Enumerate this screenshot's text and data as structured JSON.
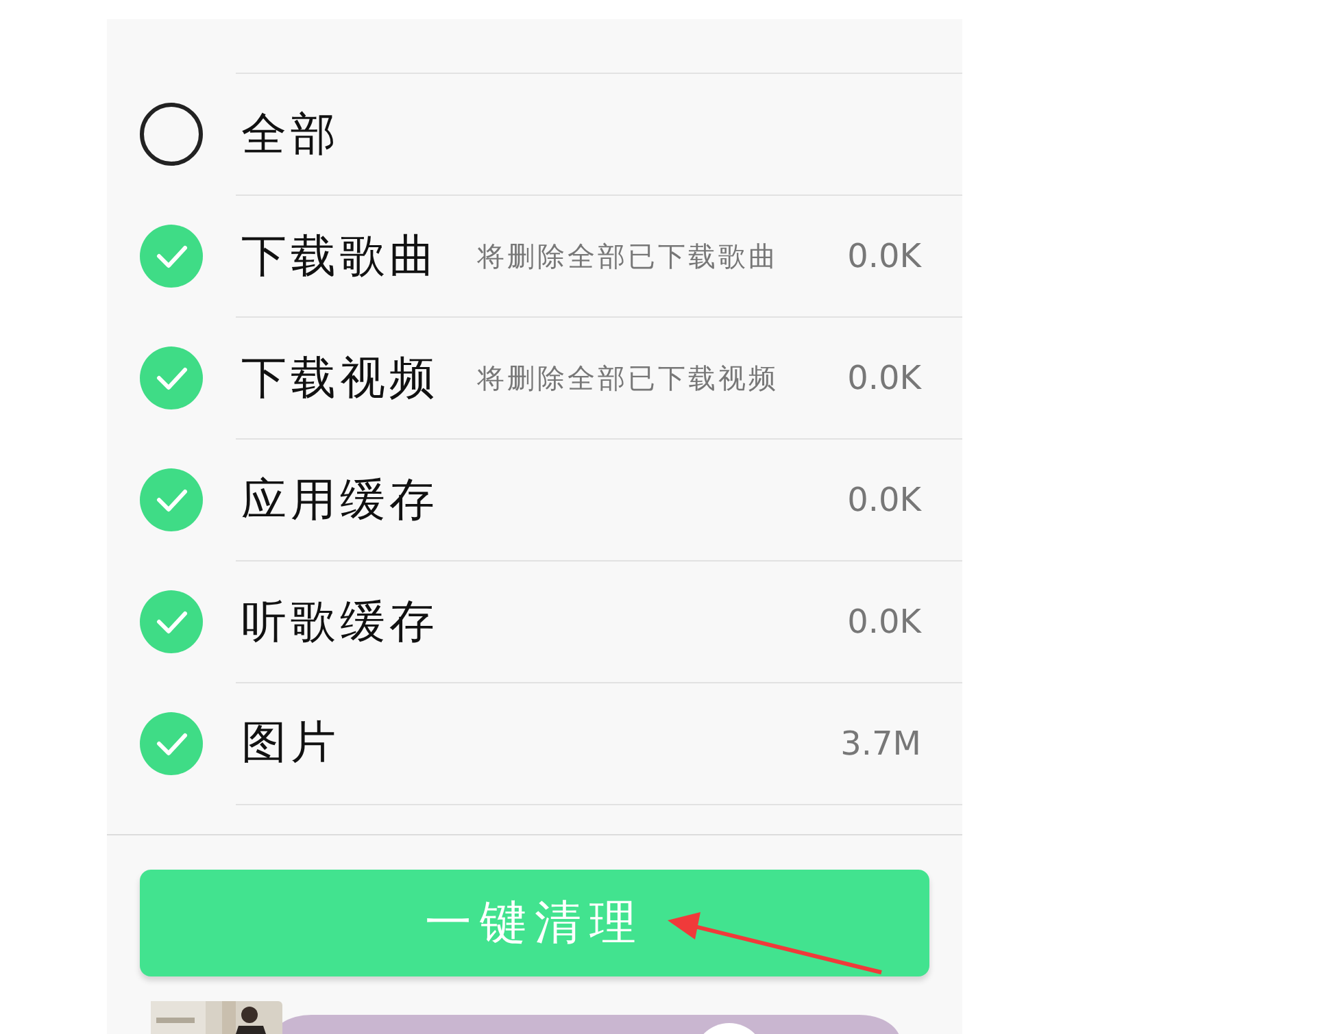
{
  "items": [
    {
      "label": "全部",
      "checked": false
    },
    {
      "label": "下载歌曲",
      "description": "将删除全部已下载歌曲",
      "size": "0.0K",
      "checked": true
    },
    {
      "label": "下载视频",
      "description": "将删除全部已下载视频",
      "size": "0.0K",
      "checked": true
    },
    {
      "label": "应用缓存",
      "size": "0.0K",
      "checked": true
    },
    {
      "label": "听歌缓存",
      "size": "0.0K",
      "checked": true
    },
    {
      "label": "图片",
      "size": "3.7M",
      "checked": true
    }
  ],
  "clean_button": "一键清理"
}
